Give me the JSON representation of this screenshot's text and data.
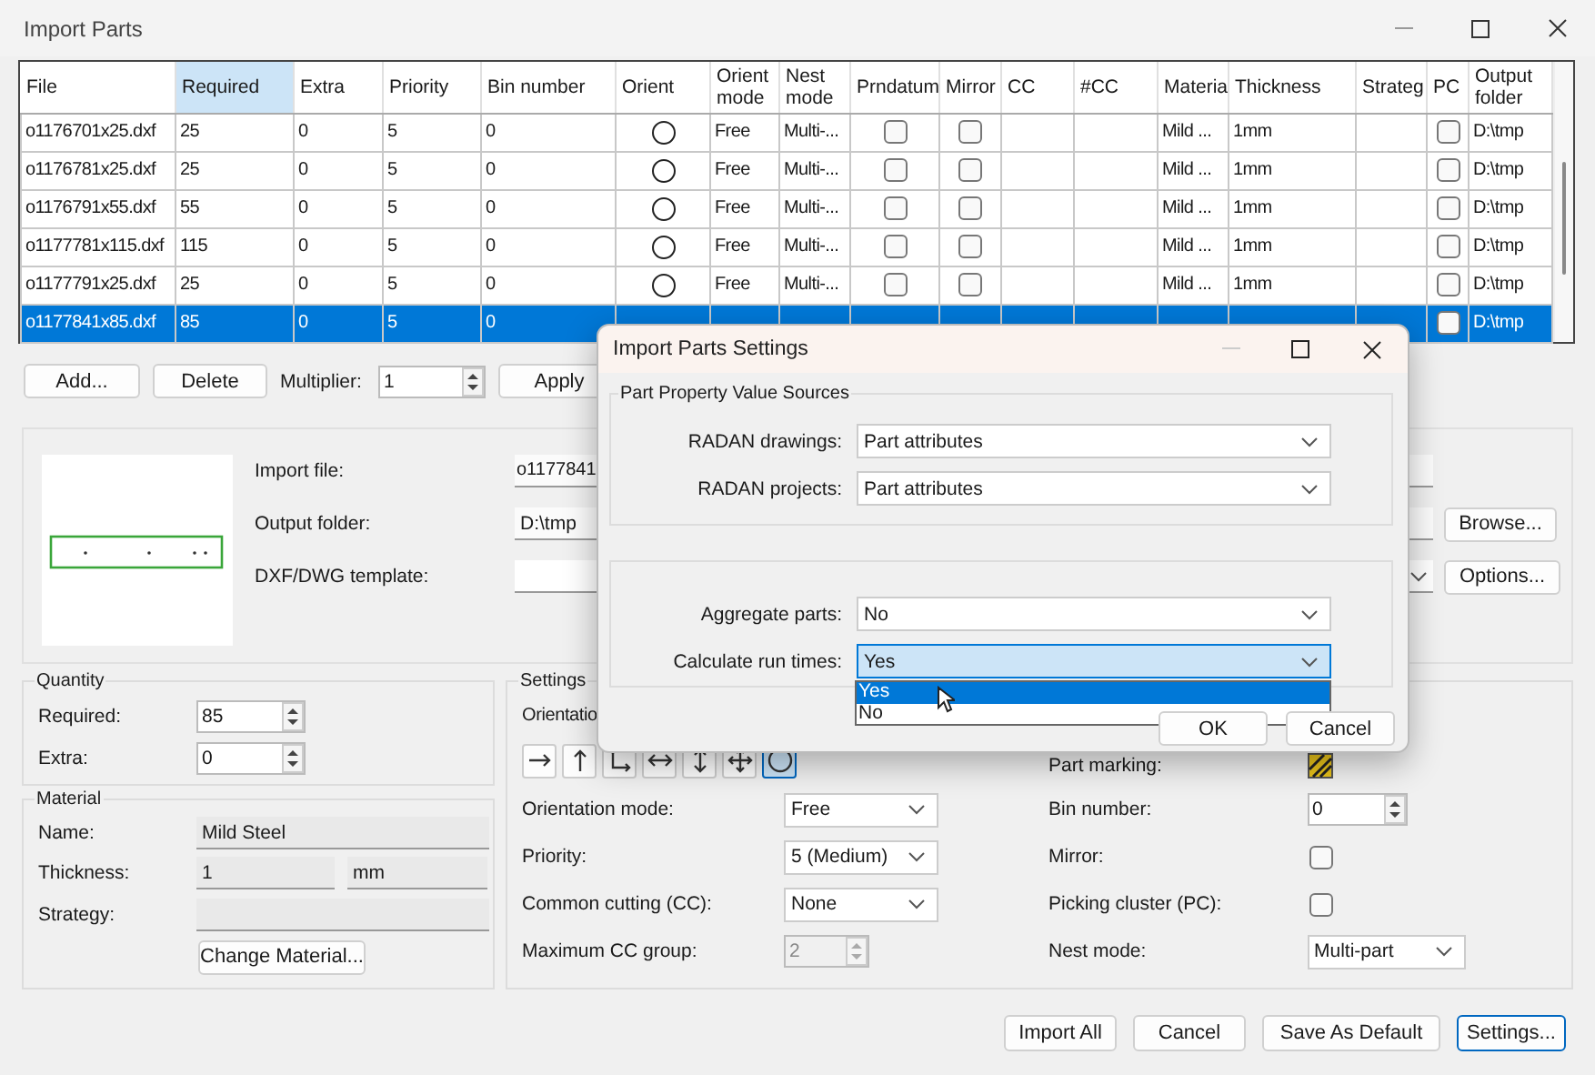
{
  "window": {
    "title": "Import Parts"
  },
  "table": {
    "columns": [
      {
        "label": "File",
        "kind": "text",
        "selected": false
      },
      {
        "label": "Required",
        "kind": "text",
        "selected": true
      },
      {
        "label": "Extra",
        "kind": "text",
        "selected": false
      },
      {
        "label": "Priority",
        "kind": "text",
        "selected": false
      },
      {
        "label": "Bin number",
        "kind": "text",
        "selected": false
      },
      {
        "label": "Orient",
        "kind": "radio",
        "selected": false
      },
      {
        "label": "Orient mode",
        "kind": "text",
        "selected": false
      },
      {
        "label": "Nest mode",
        "kind": "text",
        "selected": false
      },
      {
        "label": "Prndatum",
        "kind": "check",
        "selected": false
      },
      {
        "label": "Mirror",
        "kind": "check",
        "selected": false
      },
      {
        "label": "CC",
        "kind": "text",
        "selected": false
      },
      {
        "label": "#CC",
        "kind": "text",
        "selected": false
      },
      {
        "label": "Materia",
        "kind": "text",
        "selected": false
      },
      {
        "label": "Thickness",
        "kind": "text",
        "selected": false
      },
      {
        "label": "Strateg",
        "kind": "text",
        "selected": false
      },
      {
        "label": "PC",
        "kind": "check",
        "selected": false
      },
      {
        "label": "Output folder",
        "kind": "text",
        "selected": false
      }
    ],
    "rows": [
      {
        "selected": false,
        "cells": [
          "o1176701x25.dxf",
          "25",
          "0",
          "5",
          "0",
          false,
          "Free",
          "Multi-...",
          false,
          false,
          null,
          null,
          "Mild ...",
          "1mm",
          null,
          false,
          "D:\\tmp"
        ]
      },
      {
        "selected": false,
        "cells": [
          "o1176781x25.dxf",
          "25",
          "0",
          "5",
          "0",
          false,
          "Free",
          "Multi-...",
          false,
          false,
          null,
          null,
          "Mild ...",
          "1mm",
          null,
          false,
          "D:\\tmp"
        ]
      },
      {
        "selected": false,
        "cells": [
          "o1176791x55.dxf",
          "55",
          "0",
          "5",
          "0",
          false,
          "Free",
          "Multi-...",
          false,
          false,
          null,
          null,
          "Mild ...",
          "1mm",
          null,
          false,
          "D:\\tmp"
        ]
      },
      {
        "selected": false,
        "cells": [
          "o1177781x115.dxf",
          "115",
          "0",
          "5",
          "0",
          false,
          "Free",
          "Multi-...",
          false,
          false,
          null,
          null,
          "Mild ...",
          "1mm",
          null,
          false,
          "D:\\tmp"
        ]
      },
      {
        "selected": false,
        "cells": [
          "o1177791x25.dxf",
          "25",
          "0",
          "5",
          "0",
          false,
          "Free",
          "Multi-...",
          false,
          false,
          null,
          null,
          "Mild ...",
          "1mm",
          null,
          false,
          "D:\\tmp"
        ]
      },
      {
        "selected": true,
        "cells": [
          "o1177841x85.dxf",
          "85",
          "0",
          "5",
          "0",
          null,
          null,
          null,
          null,
          null,
          null,
          null,
          null,
          null,
          null,
          false,
          "D:\\tmp"
        ]
      }
    ]
  },
  "actions": {
    "add": "Add...",
    "delete": "Delete",
    "multiplier_label": "Multiplier:",
    "multiplier": "1",
    "apply": "Apply"
  },
  "details": {
    "import_file_label": "Import file:",
    "import_file": "o1177841",
    "output_folder_label": "Output folder:",
    "output_folder": "D:\\tmp",
    "template_label": "DXF/DWG template:",
    "browse": "Browse...",
    "options": "Options..."
  },
  "quantity": {
    "title": "Quantity",
    "required_label": "Required:",
    "required": "85",
    "extra_label": "Extra:",
    "extra": "0"
  },
  "material": {
    "title": "Material",
    "name_label": "Name:",
    "name": "Mild Steel",
    "thickness_label": "Thickness:",
    "thickness": "1",
    "unit": "mm",
    "strategy_label": "Strategy:",
    "change": "Change Material..."
  },
  "settings": {
    "title": "Settings",
    "orientation_label": "Orientatio",
    "orientation_buttons": [
      {
        "selected": false
      },
      {
        "selected": false
      },
      {
        "selected": false
      },
      {
        "selected": false
      },
      {
        "selected": false
      },
      {
        "selected": false
      },
      {
        "selected": true
      }
    ],
    "left": [
      {
        "kind": "select",
        "label": "Orientation mode:",
        "value": "Free",
        "disabled": false
      },
      {
        "kind": "select",
        "label": "Priority:",
        "value": "5 (Medium)",
        "disabled": false
      },
      {
        "kind": "select",
        "label": "Common cutting (CC):",
        "value": "None",
        "disabled": false
      },
      {
        "kind": "spin",
        "label": "Maximum CC group:",
        "value": "2",
        "disabled": true
      }
    ],
    "right": [
      {
        "kind": "icon",
        "label": "Part marking:"
      },
      {
        "kind": "spin",
        "label": "Bin number:",
        "value": "0",
        "disabled": false
      },
      {
        "kind": "check",
        "label": "Mirror:",
        "checked": false
      },
      {
        "kind": "check",
        "label": "Picking cluster (PC):",
        "checked": false
      },
      {
        "kind": "select",
        "label": "Nest mode:",
        "value": "Multi-part",
        "disabled": false
      }
    ]
  },
  "footer": [
    {
      "label": "Import All",
      "focused": false
    },
    {
      "label": "Cancel",
      "focused": false
    },
    {
      "label": "Save As Default",
      "focused": false
    },
    {
      "label": "Settings...",
      "focused": true
    }
  ],
  "dialog": {
    "title": "Import Parts Settings",
    "groups": [
      {
        "title": "Part Property Value Sources",
        "rows": [
          {
            "label": "RADAN drawings:",
            "value": "Part attributes",
            "open": false
          },
          {
            "label": "RADAN projects:",
            "value": "Part attributes",
            "open": false
          }
        ]
      },
      {
        "rows": [
          {
            "label": "Aggregate parts:",
            "value": "No",
            "open": false
          },
          {
            "label": "Calculate run times:",
            "value": "Yes",
            "open": true,
            "options": [
              {
                "label": "Yes",
                "selected": true
              },
              {
                "label": "No",
                "selected": false
              }
            ]
          }
        ]
      }
    ],
    "buttons": [
      "OK",
      "Cancel"
    ]
  }
}
